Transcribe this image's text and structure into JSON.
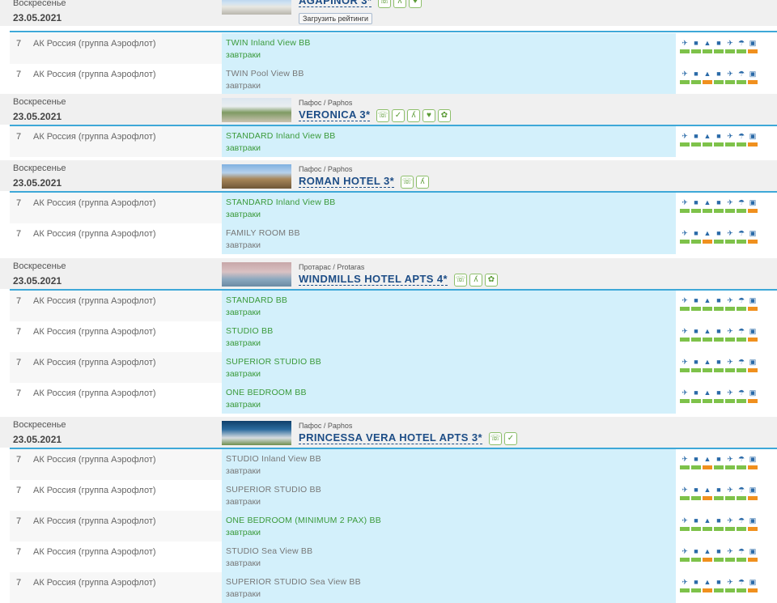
{
  "common": {
    "day": "Воскресенье",
    "date": "23.05.2021",
    "nights": "7",
    "airline": "АК Россия (группа Аэрофлот)",
    "rating_button": "Загрузить рейтинги",
    "meal": "завтраки"
  },
  "colors": {
    "room_bg": "#d3f0fb",
    "separator": "#3ea8d8",
    "hotel_name": "#1d4d86",
    "room_available": "#3a9a3a",
    "room_limited": "#777777",
    "status_ok": "#7ec24a",
    "status_warn": "#f0901e"
  },
  "status_icons": [
    "plane-out-icon",
    "bus-icon",
    "hotel-icon",
    "bus-icon",
    "plane-back-icon",
    "insurance-icon",
    "visa-icon"
  ],
  "hotels": [
    {
      "name": "AGAPINOR 3*",
      "region": "",
      "badges": [
        "phone-icon",
        "walk-icon",
        "heart-icon"
      ],
      "offers": [
        {
          "room": "TWIN Inland View BB",
          "color": "#3a9a3a",
          "status": [
            "ok",
            "ok",
            "ok",
            "ok",
            "ok",
            "ok",
            "warn"
          ]
        },
        {
          "room": "TWIN Pool View BB",
          "color": "#777777",
          "status": [
            "ok",
            "ok",
            "warn",
            "ok",
            "ok",
            "ok",
            "warn"
          ]
        }
      ]
    },
    {
      "name": "VERONICA 3*",
      "region": "Пафос / Paphos",
      "badges": [
        "phone-icon",
        "thumb-up-icon",
        "walk-icon",
        "heart-icon",
        "gift-icon"
      ],
      "offers": [
        {
          "room": "STANDARD Inland View BB",
          "color": "#3a9a3a",
          "status": [
            "ok",
            "ok",
            "ok",
            "ok",
            "ok",
            "ok",
            "warn"
          ]
        }
      ]
    },
    {
      "name": "ROMAN HOTEL 3*",
      "region": "Пафос / Paphos",
      "badges": [
        "phone-icon",
        "walk-icon"
      ],
      "offers": [
        {
          "room": "STANDARD Inland View BB",
          "color": "#3a9a3a",
          "status": [
            "ok",
            "ok",
            "ok",
            "ok",
            "ok",
            "ok",
            "warn"
          ]
        },
        {
          "room": "FAMILY ROOM BB",
          "color": "#777777",
          "status": [
            "ok",
            "ok",
            "warn",
            "ok",
            "ok",
            "ok",
            "warn"
          ]
        }
      ]
    },
    {
      "name": "WINDMILLS HOTEL APTS 4*",
      "region": "Протарас / Protaras",
      "badges": [
        "phone-icon",
        "walk-icon",
        "gift-icon"
      ],
      "offers": [
        {
          "room": "STANDARD BB",
          "color": "#3a9a3a",
          "status": [
            "ok",
            "ok",
            "ok",
            "ok",
            "ok",
            "ok",
            "warn"
          ]
        },
        {
          "room": "STUDIO BB",
          "color": "#3a9a3a",
          "status": [
            "ok",
            "ok",
            "ok",
            "ok",
            "ok",
            "ok",
            "warn"
          ]
        },
        {
          "room": "SUPERIOR STUDIO BB",
          "color": "#3a9a3a",
          "status": [
            "ok",
            "ok",
            "ok",
            "ok",
            "ok",
            "ok",
            "warn"
          ]
        },
        {
          "room": "ONE BEDROOM BB",
          "color": "#3a9a3a",
          "status": [
            "ok",
            "ok",
            "ok",
            "ok",
            "ok",
            "ok",
            "warn"
          ]
        }
      ]
    },
    {
      "name": "PRINCESSA VERA HOTEL APTS 3*",
      "region": "Пафос / Paphos",
      "badges": [
        "phone-icon",
        "thumb-up-icon"
      ],
      "offers": [
        {
          "room": "STUDIO Inland View BB",
          "color": "#777777",
          "status": [
            "ok",
            "ok",
            "warn",
            "ok",
            "ok",
            "ok",
            "warn"
          ]
        },
        {
          "room": "SUPERIOR STUDIO BB",
          "color": "#777777",
          "status": [
            "ok",
            "ok",
            "warn",
            "ok",
            "ok",
            "ok",
            "warn"
          ]
        },
        {
          "room": "ONE BEDROOM (MINIMUM 2 PAX) BB",
          "color": "#3a9a3a",
          "status": [
            "ok",
            "ok",
            "ok",
            "ok",
            "ok",
            "ok",
            "warn"
          ]
        },
        {
          "room": "STUDIO Sea View BB",
          "color": "#777777",
          "status": [
            "ok",
            "ok",
            "warn",
            "ok",
            "ok",
            "ok",
            "warn"
          ]
        },
        {
          "room": "SUPERIOR STUDIO Sea View BB",
          "color": "#777777",
          "status": [
            "ok",
            "ok",
            "warn",
            "ok",
            "ok",
            "ok",
            "warn"
          ]
        }
      ]
    }
  ]
}
